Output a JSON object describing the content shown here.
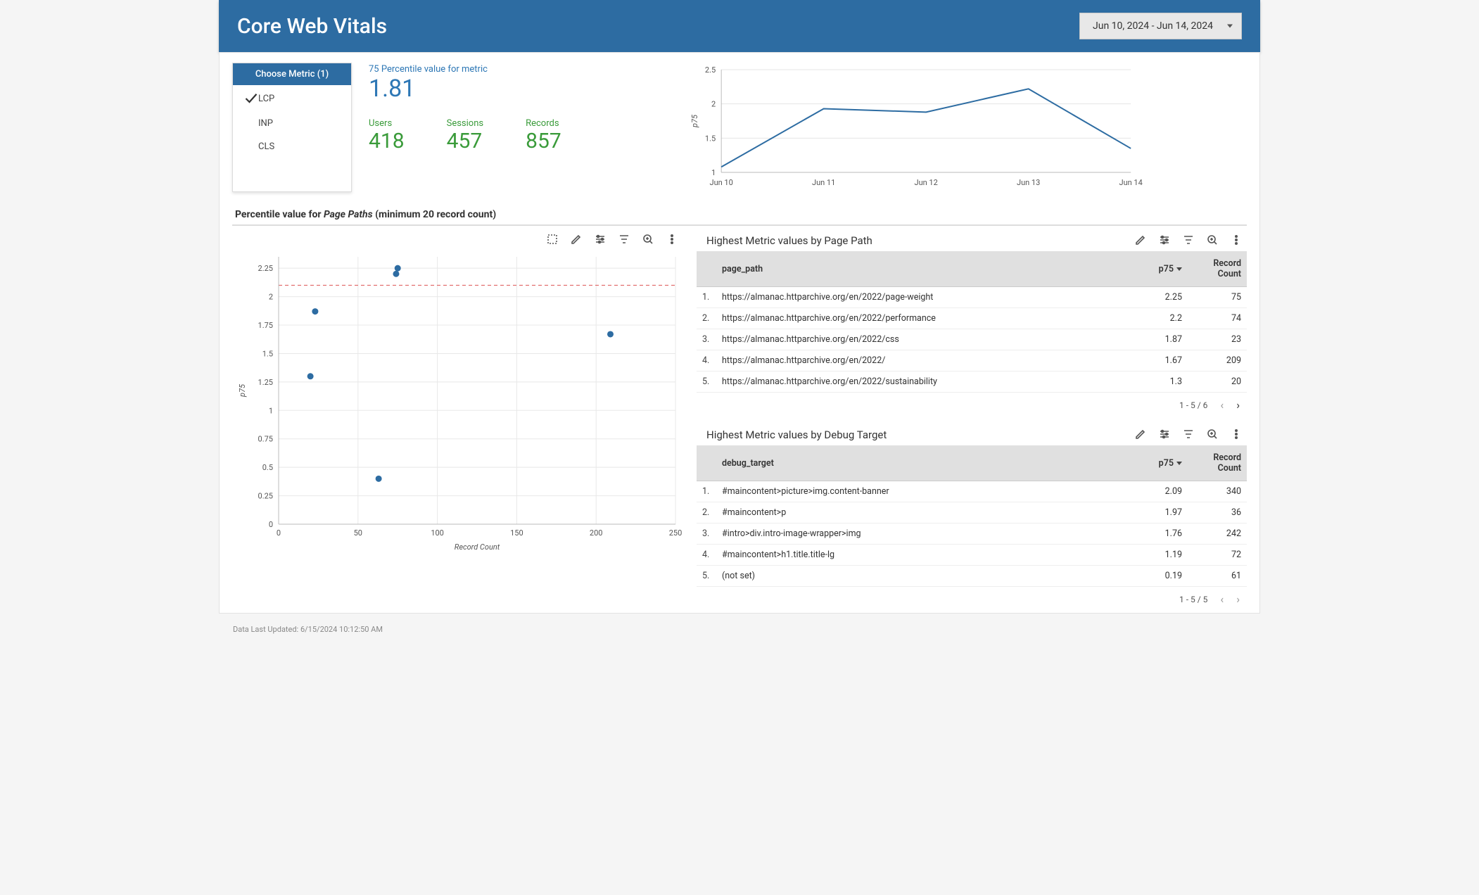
{
  "header": {
    "title": "Core Web Vitals",
    "date_range": "Jun 10, 2024 - Jun 14, 2024"
  },
  "metric_selector": {
    "title": "Choose Metric (1)",
    "options": [
      {
        "label": "LCP",
        "checked": true
      },
      {
        "label": "INP",
        "checked": false
      },
      {
        "label": "CLS",
        "checked": false
      }
    ]
  },
  "kpis": {
    "p75_label": "75 Percentile value for metric",
    "p75_value": "1.81",
    "users_label": "Users",
    "users_value": "418",
    "sessions_label": "Sessions",
    "sessions_value": "457",
    "records_label": "Records",
    "records_value": "857"
  },
  "section_title": {
    "pre": "Percentile value for ",
    "em": "Page Paths",
    "post": " (minimum 20 record count)"
  },
  "chart_data": [
    {
      "id": "p75_trend",
      "type": "line",
      "title": "",
      "xlabel": "",
      "ylabel": "p75",
      "x_categories": [
        "Jun 10",
        "Jun 11",
        "Jun 12",
        "Jun 13",
        "Jun 14"
      ],
      "ylim": [
        1,
        2.5
      ],
      "y_ticks": [
        1,
        1.5,
        2,
        2.5
      ],
      "series": [
        {
          "name": "p75",
          "values": [
            1.08,
            1.93,
            1.88,
            2.22,
            1.35
          ]
        }
      ]
    },
    {
      "id": "scatter_page_paths",
      "type": "scatter",
      "title": "Percentile value for Page Paths (minimum 20 record count)",
      "xlabel": "Record Count",
      "ylabel": "p75",
      "xlim": [
        0,
        250
      ],
      "x_ticks": [
        0,
        50,
        100,
        150,
        200,
        250
      ],
      "ylim": [
        0,
        2.35
      ],
      "y_ticks": [
        0,
        0.25,
        0.5,
        0.75,
        1,
        1.25,
        1.5,
        1.75,
        2,
        2.25
      ],
      "reference_line_y": 2.1,
      "points": [
        {
          "x": 20,
          "y": 1.3
        },
        {
          "x": 23,
          "y": 1.87
        },
        {
          "x": 63,
          "y": 0.4
        },
        {
          "x": 74,
          "y": 2.2
        },
        {
          "x": 75,
          "y": 2.25
        },
        {
          "x": 209,
          "y": 1.67
        }
      ]
    }
  ],
  "page_path_table": {
    "title": "Highest Metric values by Page Path",
    "columns": {
      "c1": "page_path",
      "c2": "p75",
      "c3": "Record Count"
    },
    "rows": [
      {
        "idx": "1.",
        "path": "https://almanac.httparchive.org/en/2022/page-weight",
        "p75": "2.25",
        "count": "75"
      },
      {
        "idx": "2.",
        "path": "https://almanac.httparchive.org/en/2022/performance",
        "p75": "2.2",
        "count": "74"
      },
      {
        "idx": "3.",
        "path": "https://almanac.httparchive.org/en/2022/css",
        "p75": "1.87",
        "count": "23"
      },
      {
        "idx": "4.",
        "path": "https://almanac.httparchive.org/en/2022/",
        "p75": "1.67",
        "count": "209"
      },
      {
        "idx": "5.",
        "path": "https://almanac.httparchive.org/en/2022/sustainability",
        "p75": "1.3",
        "count": "20"
      }
    ],
    "pager": "1 - 5 / 6"
  },
  "debug_target_table": {
    "title": "Highest Metric values by Debug Target",
    "columns": {
      "c1": "debug_target",
      "c2": "p75",
      "c3": "Record Count"
    },
    "rows": [
      {
        "idx": "1.",
        "path": "#maincontent>picture>img.content-banner",
        "p75": "2.09",
        "count": "340"
      },
      {
        "idx": "2.",
        "path": "#maincontent>p",
        "p75": "1.97",
        "count": "36"
      },
      {
        "idx": "3.",
        "path": "#intro>div.intro-image-wrapper>img",
        "p75": "1.76",
        "count": "242"
      },
      {
        "idx": "4.",
        "path": "#maincontent>h1.title.title-lg",
        "p75": "1.19",
        "count": "72"
      },
      {
        "idx": "5.",
        "path": "(not set)",
        "p75": "0.19",
        "count": "61"
      }
    ],
    "pager": "1 - 5 / 5"
  },
  "footer": {
    "updated": "Data Last Updated: 6/15/2024 10:12:50 AM"
  }
}
